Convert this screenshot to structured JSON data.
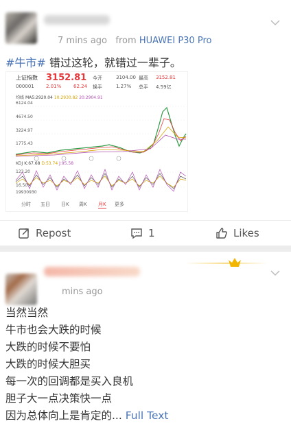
{
  "post1": {
    "time": "7 mins ago",
    "from_label": "from",
    "device": "HUAWEI P30 Pro",
    "hashtag": "#牛市#",
    "text": " 错过这轮，就错过一辈子。",
    "stock": {
      "name": "上证指数",
      "code": "000001",
      "price": "3152.81",
      "change_pct": "2.01%",
      "change": "62.24",
      "today_label": "今开",
      "today_val": "3104.00",
      "turnover_label": "换手",
      "turnover_val": "1.27%",
      "high_label": "最高",
      "high_val": "3152.81",
      "total_label": "总手",
      "total_val": "4.59亿",
      "ma_label": "均线",
      "ma5": "MA5:2920.04",
      "ma10": "10:2930.82",
      "ma20": "20:2904.91",
      "y1": "6124.04",
      "y2": "4674.50",
      "y3": "3224.97",
      "y4": "1775.43",
      "kdj_label": "KDJ",
      "k": "K:67.68",
      "d": "D:53.74",
      "j": "J:95.58",
      "ky1": "123.20",
      "ky2": "16.50",
      "vol": "19930930",
      "tabs": [
        "分时",
        "五日",
        "日K",
        "周K",
        "月K",
        "更多"
      ]
    },
    "actions": {
      "repost": "Repost",
      "comments": "1",
      "likes": "Likes"
    }
  },
  "post2": {
    "time": "mins ago",
    "lines": [
      "当然当然",
      "牛市也会大跌的时候",
      "大跌的时候不要怕",
      "大跌的时候大胆买",
      "每一次的回调都是买入良机",
      "胆子大一点决策快一点"
    ],
    "last_line": "因为总体向上是肯定的...",
    "full_text": " Full Text"
  },
  "colors": {
    "link": "#4a74b5",
    "red": "#e4393c",
    "green": "#2e9a44"
  }
}
